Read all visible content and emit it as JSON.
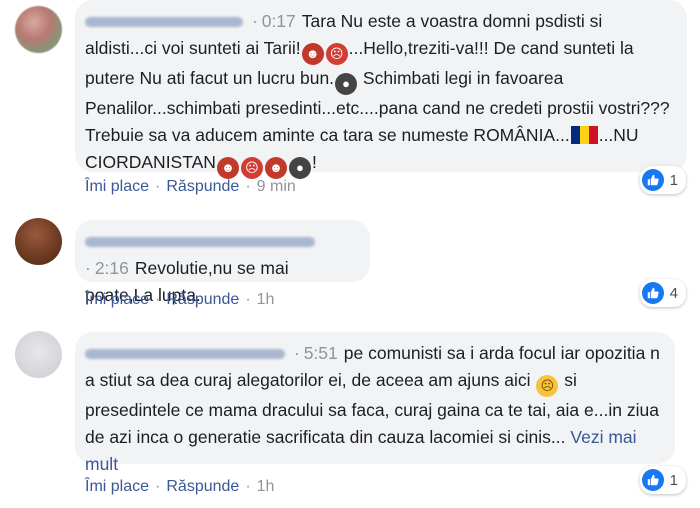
{
  "comments": [
    {
      "timestamp": "0:17",
      "segments": {
        "s1": "Tara Nu este a voastra domni psdisti si aldisti...ci voi sunteti ai Tarii!",
        "s2": "...Hello,treziti-va!!! De cand sunteti la putere Nu ati facut un lucru bun.",
        "s3": "Schimbati legi in favoarea Penalilor...schimbati presedinti...etc....pana cand ne credeti prostii vostri???Trebuie sa va aducem aminte ca tara se numeste ROMÂNIA...",
        "s4": "...NU CIORDANISTAN",
        "s5": "!"
      },
      "actions": {
        "like": "Îmi place",
        "reply": "Răspunde",
        "time": "9 min"
      },
      "reactions": {
        "icon": "like-icon",
        "count": "1"
      }
    },
    {
      "timestamp": "2:16",
      "text": "Revolutie,nu se mai poate,La lupta.",
      "actions": {
        "like": "Îmi place",
        "reply": "Răspunde",
        "time": "1h"
      },
      "reactions": {
        "icon": "like-icon",
        "count": "4"
      }
    },
    {
      "timestamp": "5:51",
      "segments": {
        "s1": "pe comunisti sa i arda focul iar opozitia n a stiut sa dea curaj alegatorilor ei, de aceea am ajuns aici",
        "s2": "si presedintele ce mama dracului sa faca, curaj gaina ca te tai, aia e...in ziua de azi inca o generatie sacrificata din cauza lacomiei si cinis...",
        "see_more": "Vezi mai mult"
      },
      "actions": {
        "like": "Îmi place",
        "reply": "Răspunde",
        "time": "1h"
      },
      "reactions": {
        "icon": "like-icon",
        "count": "1"
      }
    }
  ],
  "colors": {
    "bubble": "#f2f3f5",
    "link": "#385898",
    "like_blue": "#1877f2",
    "meta": "#90949c"
  },
  "flag": {
    "blue": "#002b7f",
    "yellow": "#fcd116",
    "red": "#ce1126"
  }
}
